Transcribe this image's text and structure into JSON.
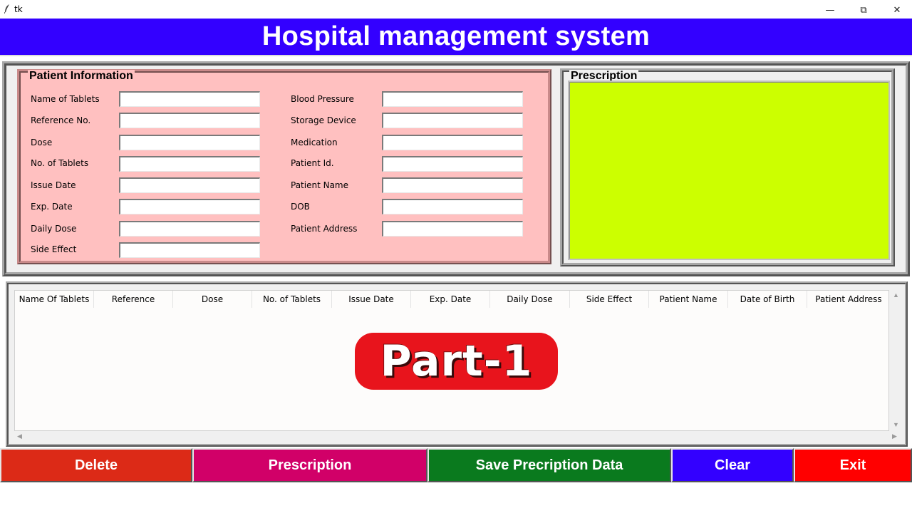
{
  "window": {
    "app_title": "tk",
    "controls": {
      "minimize": "—",
      "maximize": "⧉",
      "close": "✕"
    }
  },
  "header": {
    "title": "Hospital management system"
  },
  "patient_info": {
    "frame_label": "Patient Information",
    "left_fields": [
      {
        "label": "Name of Tablets",
        "value": ""
      },
      {
        "label": "Reference No.",
        "value": ""
      },
      {
        "label": "Dose",
        "value": ""
      },
      {
        "label": "No. of Tablets",
        "value": ""
      },
      {
        "label": "Issue Date",
        "value": ""
      },
      {
        "label": "Exp. Date",
        "value": ""
      },
      {
        "label": "Daily Dose",
        "value": ""
      },
      {
        "label": "Side Effect",
        "value": ""
      }
    ],
    "right_fields": [
      {
        "label": "Blood Pressure",
        "value": ""
      },
      {
        "label": "Storage Device",
        "value": ""
      },
      {
        "label": "Medication",
        "value": ""
      },
      {
        "label": "Patient Id.",
        "value": ""
      },
      {
        "label": "Patient Name",
        "value": ""
      },
      {
        "label": "DOB",
        "value": ""
      },
      {
        "label": "Patient Address",
        "value": ""
      }
    ]
  },
  "prescription": {
    "frame_label": "Prescription",
    "text": ""
  },
  "table": {
    "columns": [
      "Name Of Tablets",
      "Reference",
      "Dose",
      "No. of Tablets",
      "Issue Date",
      "Exp. Date",
      "Daily Dose",
      "Side Effect",
      "Patient Name",
      "Date of Birth",
      "Patient Address"
    ],
    "rows": []
  },
  "badge": {
    "text": "Part-1"
  },
  "buttons": {
    "delete": "Delete",
    "prescription": "Prescription",
    "save": "Save Precription Data",
    "clear": "Clear",
    "exit": "Exit"
  },
  "colors": {
    "header_bg": "#3300ff",
    "patient_frame_bg": "#ffc0c0",
    "prescription_bg": "#ccff00",
    "delete_btn": "#dc2a17",
    "prescription_btn": "#d10068",
    "save_btn": "#0a7a1e",
    "clear_btn": "#3300ff",
    "exit_btn": "#ff0000"
  },
  "icons": {
    "app": "feather-icon",
    "scroll_up": "arrow-up-icon",
    "scroll_down": "arrow-down-icon",
    "scroll_left": "arrow-left-icon",
    "scroll_right": "arrow-right-icon"
  }
}
